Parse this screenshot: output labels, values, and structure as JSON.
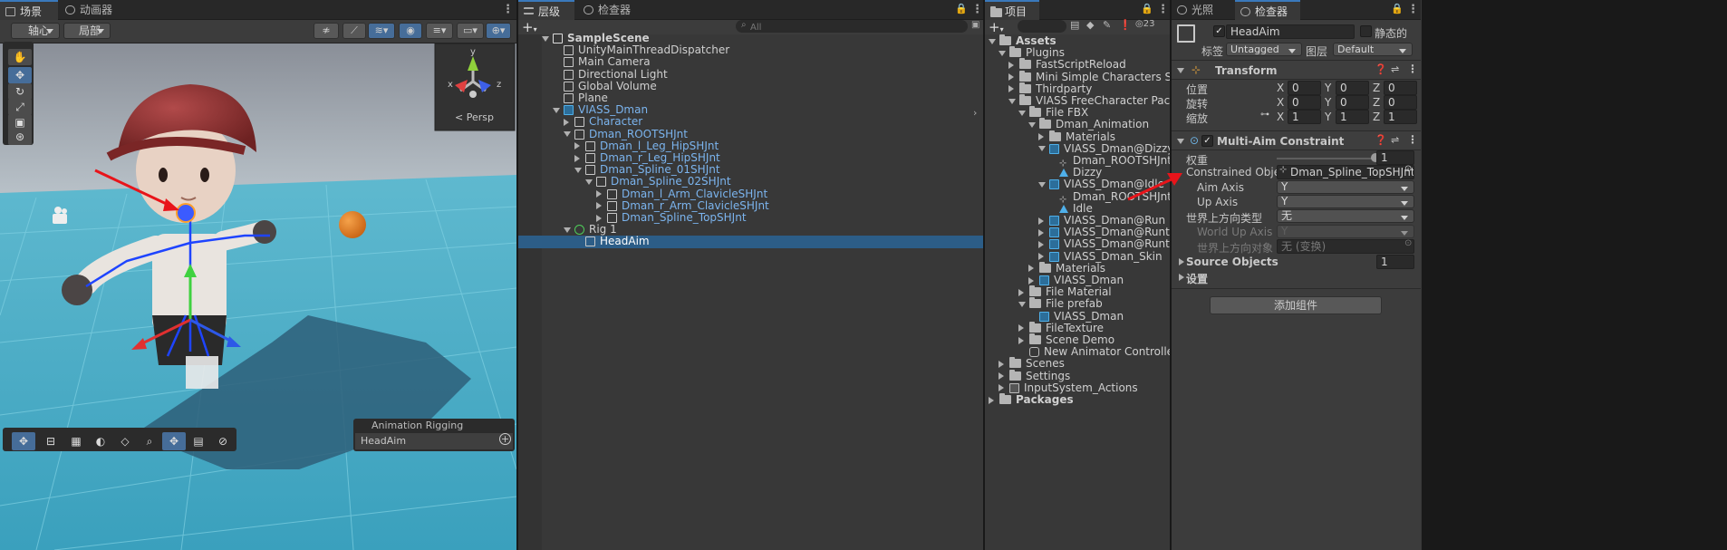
{
  "scene": {
    "tabs": [
      {
        "label": "场景"
      },
      {
        "label": "动画器"
      }
    ],
    "pivot_label": "轴心",
    "local_label": "局部",
    "gizmo_axis_x": "x",
    "gizmo_axis_y": "y",
    "gizmo_axis_z": "z",
    "persp_label": "< Persp",
    "overlay_title": "Animation Rigging",
    "overlay_item": "HeadAim"
  },
  "hierarchy": {
    "tabs": [
      {
        "label": "层级"
      },
      {
        "label": "检查器"
      }
    ],
    "search_placeholder": "All",
    "rows": [
      {
        "label": "SampleScene",
        "indent": 0,
        "expanded": true,
        "icon": "scene-icon",
        "bold": true
      },
      {
        "label": "UnityMainThreadDispatcher",
        "indent": 1,
        "icon": "gameobject-icon"
      },
      {
        "label": "Main Camera",
        "indent": 1,
        "icon": "gameobject-icon"
      },
      {
        "label": "Directional Light",
        "indent": 1,
        "icon": "gameobject-icon"
      },
      {
        "label": "Global Volume",
        "indent": 1,
        "icon": "gameobject-icon"
      },
      {
        "label": "Plane",
        "indent": 1,
        "icon": "gameobject-icon"
      },
      {
        "label": "VIASS_Dman",
        "indent": 1,
        "expanded": true,
        "icon": "prefab-icon",
        "blue": true
      },
      {
        "label": "Character",
        "indent": 2,
        "collapsed": true,
        "icon": "gameobject-icon",
        "blue": true
      },
      {
        "label": "Dman_ROOTSHJnt",
        "indent": 2,
        "expanded": true,
        "icon": "gameobject-icon",
        "blue": true
      },
      {
        "label": "Dman_l_Leg_HipSHJnt",
        "indent": 3,
        "collapsed": true,
        "icon": "gameobject-icon",
        "blue": true
      },
      {
        "label": "Dman_r_Leg_HipSHJnt",
        "indent": 3,
        "collapsed": true,
        "icon": "gameobject-icon",
        "blue": true
      },
      {
        "label": "Dman_Spline_01SHJnt",
        "indent": 3,
        "expanded": true,
        "icon": "gameobject-icon",
        "blue": true
      },
      {
        "label": "Dman_Spline_02SHJnt",
        "indent": 4,
        "expanded": true,
        "icon": "gameobject-icon",
        "blue": true
      },
      {
        "label": "Dman_l_Arm_ClavicleSHJnt",
        "indent": 5,
        "collapsed": true,
        "icon": "gameobject-icon",
        "blue": true
      },
      {
        "label": "Dman_r_Arm_ClavicleSHJnt",
        "indent": 5,
        "collapsed": true,
        "icon": "gameobject-icon",
        "blue": true
      },
      {
        "label": "Dman_Spline_TopSHJnt",
        "indent": 5,
        "collapsed": true,
        "icon": "gameobject-icon",
        "blue": true
      },
      {
        "label": "Rig 1",
        "indent": 2,
        "expanded": true,
        "icon": "rig-icon"
      },
      {
        "label": "HeadAim",
        "indent": 3,
        "icon": "gameobject-icon",
        "selected": true
      }
    ]
  },
  "project": {
    "tab": "项目",
    "count": "23",
    "rows": [
      {
        "label": "Assets",
        "indent": 0,
        "expanded": true,
        "icon": "folder-icon",
        "bold": true
      },
      {
        "label": "Plugins",
        "indent": 1,
        "expanded": true,
        "icon": "folder-icon"
      },
      {
        "label": "FastScriptReload",
        "indent": 2,
        "collapsed": true,
        "icon": "folder-icon"
      },
      {
        "label": "Mini Simple Characters Skeleton",
        "indent": 2,
        "collapsed": true,
        "icon": "folder-icon"
      },
      {
        "label": "Thirdparty",
        "indent": 2,
        "collapsed": true,
        "icon": "folder-icon"
      },
      {
        "label": "VIASS FreeCharacter Pack",
        "indent": 2,
        "expanded": true,
        "icon": "folder-icon"
      },
      {
        "label": "File FBX",
        "indent": 3,
        "expanded": true,
        "icon": "folder-icon"
      },
      {
        "label": "Dman_Animation",
        "indent": 4,
        "expanded": true,
        "icon": "folder-icon"
      },
      {
        "label": "Materials",
        "indent": 5,
        "collapsed": true,
        "icon": "folder-icon"
      },
      {
        "label": "VIASS_Dman@Dizzy",
        "indent": 5,
        "expanded": true,
        "icon": "model-icon"
      },
      {
        "label": "Dman_ROOTSHJnt",
        "indent": 6,
        "icon": "bone-icon"
      },
      {
        "label": "Dizzy",
        "indent": 6,
        "icon": "anim-icon"
      },
      {
        "label": "VIASS_Dman@Idle",
        "indent": 5,
        "expanded": true,
        "icon": "model-icon"
      },
      {
        "label": "Dman_ROOTSHJnt",
        "indent": 6,
        "icon": "bone-icon"
      },
      {
        "label": "Idle",
        "indent": 6,
        "icon": "anim-icon"
      },
      {
        "label": "VIASS_Dman@Run",
        "indent": 5,
        "collapsed": true,
        "icon": "model-icon"
      },
      {
        "label": "VIASS_Dman@Runtojump",
        "indent": 5,
        "collapsed": true,
        "icon": "model-icon"
      },
      {
        "label": "VIASS_Dman@Runtoslide",
        "indent": 5,
        "collapsed": true,
        "icon": "model-icon"
      },
      {
        "label": "VIASS_Dman_Skin",
        "indent": 5,
        "collapsed": true,
        "icon": "model-icon"
      },
      {
        "label": "Materials",
        "indent": 4,
        "collapsed": true,
        "icon": "folder-icon"
      },
      {
        "label": "VIASS_Dman",
        "indent": 4,
        "collapsed": true,
        "icon": "model-icon"
      },
      {
        "label": "File Material",
        "indent": 3,
        "collapsed": true,
        "icon": "folder-icon"
      },
      {
        "label": "File prefab",
        "indent": 3,
        "expanded": true,
        "icon": "folder-icon"
      },
      {
        "label": "VIASS_Dman",
        "indent": 4,
        "icon": "prefab-icon"
      },
      {
        "label": "FileTexture",
        "indent": 3,
        "collapsed": true,
        "icon": "folder-icon"
      },
      {
        "label": "Scene Demo",
        "indent": 3,
        "collapsed": true,
        "icon": "folder-icon"
      },
      {
        "label": "New Animator Controller",
        "indent": 3,
        "icon": "animator-icon"
      },
      {
        "label": "Scenes",
        "indent": 1,
        "collapsed": true,
        "icon": "folder-icon"
      },
      {
        "label": "Settings",
        "indent": 1,
        "collapsed": true,
        "icon": "folder-icon"
      },
      {
        "label": "InputSystem_Actions",
        "indent": 1,
        "collapsed": true,
        "icon": "input-icon"
      },
      {
        "label": "Packages",
        "indent": 0,
        "collapsed": true,
        "icon": "folder-icon",
        "bold": true
      }
    ]
  },
  "inspector": {
    "tabs": [
      {
        "label": "光照"
      },
      {
        "label": "检查器"
      }
    ],
    "object_name": "HeadAim",
    "static_label": "静态的",
    "tag_label": "标签",
    "tag_value": "Untagged",
    "layer_label": "图层",
    "layer_value": "Default",
    "transform": {
      "title": "Transform",
      "position_label": "位置",
      "rotation_label": "旋转",
      "scale_label": "缩放",
      "position": [
        "0",
        "0",
        "0"
      ],
      "rotation": [
        "0",
        "0",
        "0"
      ],
      "scale": [
        "1",
        "1",
        "1"
      ],
      "x": "X",
      "y": "Y",
      "z": "Z"
    },
    "constraint": {
      "title": "Multi-Aim Constraint",
      "weight_label": "权重",
      "weight_value": "1",
      "weight_level": 1.0,
      "constrained_label": "Constrained Object",
      "constrained_value": "Dman_Spline_TopSHJnt (Tr",
      "aim_axis_label": "Aim Axis",
      "aim_axis_value": "Y",
      "up_axis_label": "Up Axis",
      "up_axis_value": "Y",
      "world_up_type_label": "世界上方向类型",
      "world_up_type_value": "无",
      "world_up_axis_label": "World Up Axis",
      "world_up_axis_value": "Y",
      "world_up_object_label": "世界上方向对象",
      "world_up_object_value": "无 (变换)"
    },
    "source_objects_label": "Source Objects",
    "source_objects_count": "1",
    "settings_label": "设置",
    "add_component_label": "添加组件"
  }
}
